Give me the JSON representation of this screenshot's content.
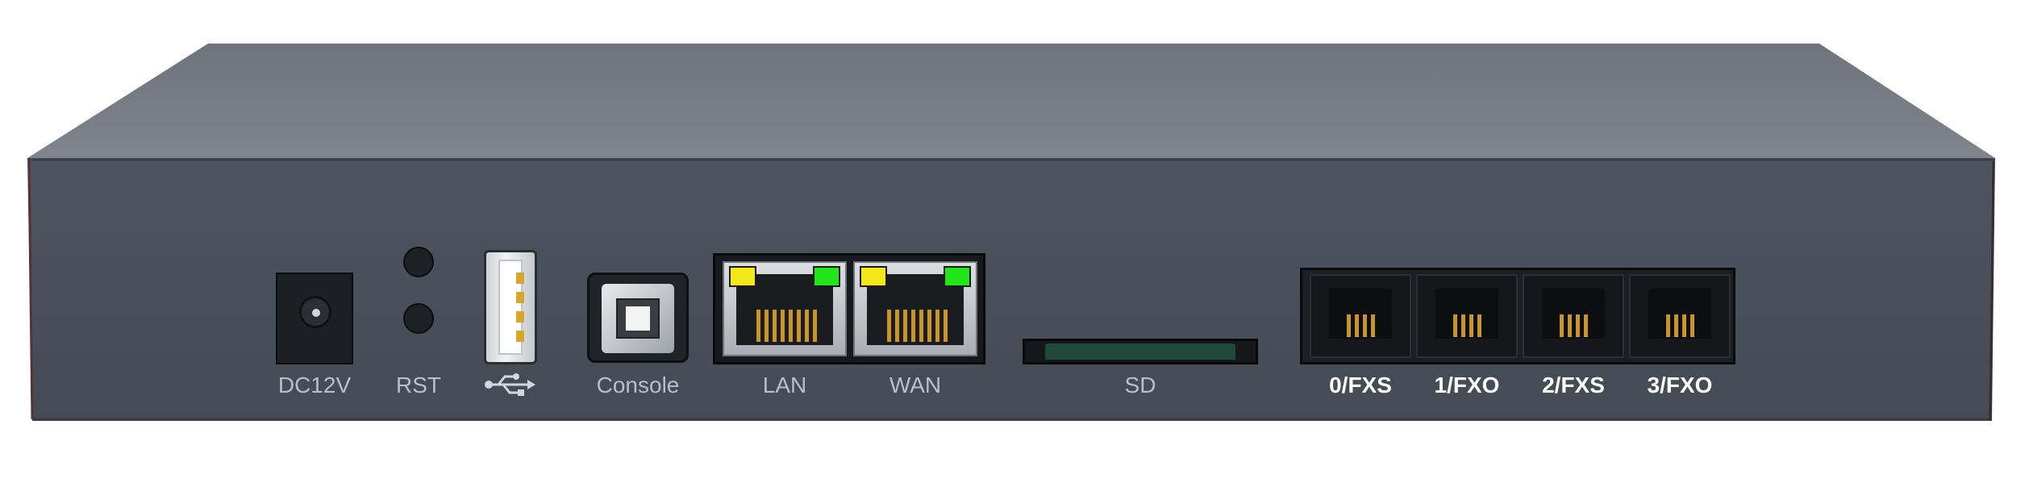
{
  "device": {
    "ports": [
      {
        "id": "dc",
        "label": "DC12V",
        "icon": "dc-power-jack-icon"
      },
      {
        "id": "rst",
        "label": "RST",
        "icon": "reset-button-icon"
      },
      {
        "id": "usb",
        "label": "",
        "icon": "usb-icon"
      },
      {
        "id": "console",
        "label": "Console",
        "icon": "usb-b-port-icon"
      },
      {
        "id": "lan",
        "label": "LAN",
        "icon": "ethernet-port-icon"
      },
      {
        "id": "wan",
        "label": "WAN",
        "icon": "ethernet-port-icon"
      },
      {
        "id": "sd",
        "label": "SD",
        "icon": "sd-slot-icon"
      },
      {
        "id": "fxs0",
        "label": "0/FXS",
        "icon": "rj11-port-icon"
      },
      {
        "id": "fxo1",
        "label": "1/FXO",
        "icon": "rj11-port-icon"
      },
      {
        "id": "fxs2",
        "label": "2/FXS",
        "icon": "rj11-port-icon"
      },
      {
        "id": "fxo3",
        "label": "3/FXO",
        "icon": "rj11-port-icon"
      }
    ],
    "colors": {
      "panel": "#4a515c",
      "top": "#777c84",
      "led_activity": "#f4e81c",
      "led_link": "#22e61a",
      "label": "#b9bfc9"
    }
  }
}
